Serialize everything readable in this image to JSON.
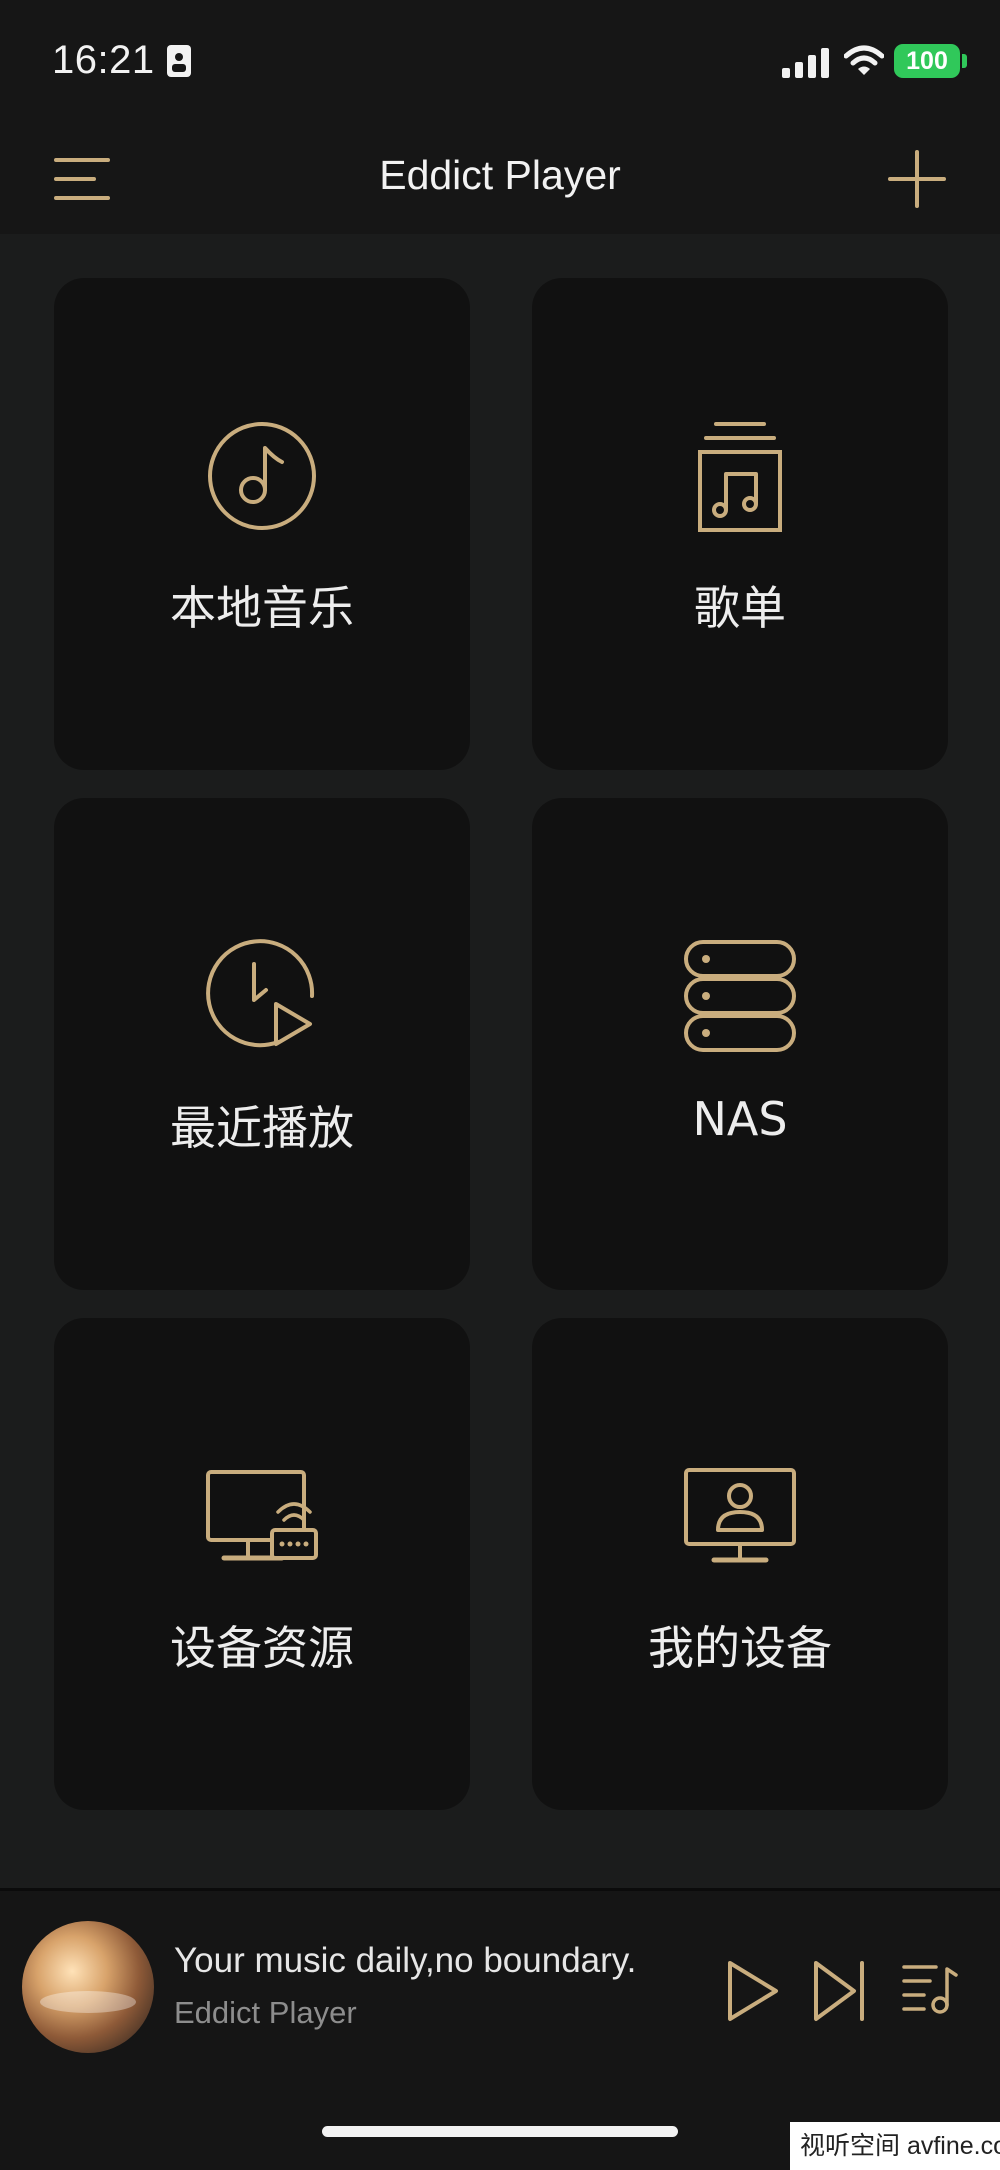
{
  "status_bar": {
    "time": "16:21",
    "battery_level": "100",
    "icons": [
      "sim-card-icon",
      "cellular-signal-icon",
      "wifi-icon",
      "battery-icon"
    ],
    "battery_color": "#30c85a"
  },
  "nav": {
    "title": "Eddict Player",
    "left_icon": "menu-icon",
    "right_icon": "add-icon"
  },
  "tiles": [
    {
      "label": "本地音乐",
      "icon": "music-note-icon"
    },
    {
      "label": "歌单",
      "icon": "playlist-icon"
    },
    {
      "label": "最近播放",
      "icon": "recent-play-icon"
    },
    {
      "label": "NAS",
      "icon": "server-icon"
    },
    {
      "label": "设备资源",
      "icon": "device-resource-icon"
    },
    {
      "label": "我的设备",
      "icon": "my-device-icon"
    }
  ],
  "player": {
    "title": "Your music daily,no boundary.",
    "subtitle": "Eddict Player",
    "icons": [
      "play-icon",
      "skip-next-icon",
      "queue-icon"
    ]
  },
  "watermark": "视听空间 avfine.com",
  "colors": {
    "accent_gold": "#c9ad7e",
    "background": "#1b1c1c",
    "tile_background": "#111111",
    "bar_background": "#161616"
  }
}
